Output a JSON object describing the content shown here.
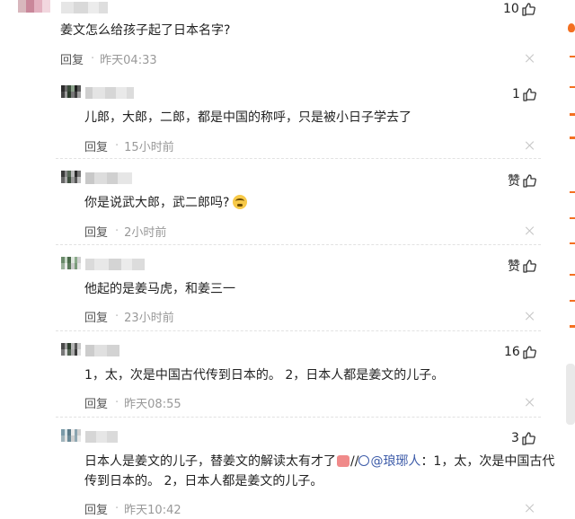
{
  "comments": [
    {
      "content": "姜文怎么给孩子起了日本名字?",
      "reply_label": "回复",
      "time": "昨天04:33",
      "like_count": "10"
    },
    {
      "content": "儿郎，大郎，二郎，都是中国的称呼，只是被小日子学去了",
      "reply_label": "回复",
      "time": "15小时前",
      "like_count": "1"
    },
    {
      "content": "你是说武大郎，武二郎吗?",
      "reply_label": "回复",
      "time": "2小时前",
      "like_count": "赞"
    },
    {
      "content": "他起的是姜马虎，和姜三一",
      "reply_label": "回复",
      "time": "23小时前",
      "like_count": "赞"
    },
    {
      "content": "1，太，次是中国古代传到日本的。 2，日本人都是姜文的儿子。",
      "reply_label": "回复",
      "time": "昨天08:55",
      "like_count": "16"
    },
    {
      "content_part1": "日本人是姜文的儿子，替姜文的解读太有才了",
      "content_part2": "//",
      "mention": "@琅琊人",
      "content_part3": "：1，太，次是中国古代",
      "content_line2": "传到日本的。 2，日本人都是姜文的儿子。",
      "reply_label": "回复",
      "time": "昨天10:42",
      "like_count": "3"
    }
  ],
  "icons": {
    "like": "thumbs-up-icon",
    "close": "close-icon",
    "emoji_face": "thinking-face-emoji-icon",
    "emoji_thumb": "thumbs-up-emoji-icon",
    "mention": "mention-at-icon"
  },
  "colors": {
    "mention": "#3b5aa8",
    "meta": "#999999",
    "accent_orange": "#f37021"
  }
}
